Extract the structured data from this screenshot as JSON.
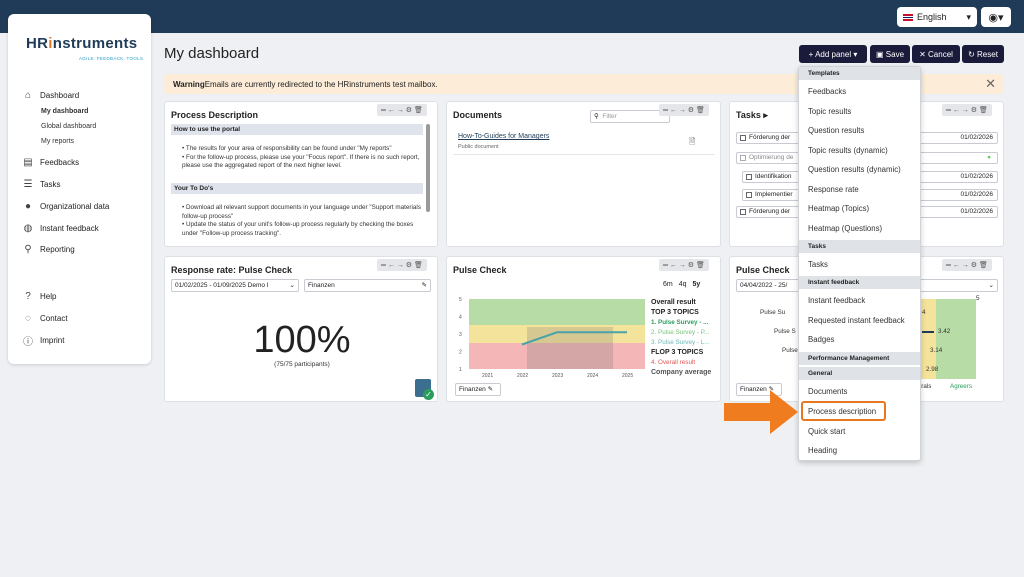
{
  "header": {
    "language": "English",
    "user_icon": "user-icon"
  },
  "sidebar": {
    "logo_main": "HR",
    "logo_mid": "i",
    "logo_rest": "nstruments",
    "tagline": "AGILE. FEEDBACK. TOOLS.",
    "dashboard": "Dashboard",
    "my_dashboard": "My dashboard",
    "global_dashboard": "Global dashboard",
    "my_reports": "My reports",
    "feedbacks": "Feedbacks",
    "tasks": "Tasks",
    "org_data": "Organizational data",
    "instant_feedback": "Instant feedback",
    "reporting": "Reporting",
    "help": "Help",
    "contact": "Contact",
    "imprint": "Imprint"
  },
  "page": {
    "title": "My dashboard",
    "add_panel": "+ Add panel",
    "save": "Save",
    "cancel": "Cancel",
    "reset": "Reset"
  },
  "warning": {
    "bold": "Warning",
    "text": " Emails are currently redirected to the HRinstruments test mailbox."
  },
  "process": {
    "title": "Process Description",
    "h1": "How to use the portal",
    "b1": "The results for your area of responsibility can be found under \"My reports\"",
    "b2": "For the follow-up process, please use your \"Focus report\". If there is no such report, please use the aggregated report of the next higher level.",
    "h2": "Your To Do's",
    "b3": "Download all relevant support documents in your language under \"Support materials follow-up process\"",
    "b4": "Update the status of your unit's follow-up process regularly by checking the boxes under \"Follow-up process tracking\"."
  },
  "documents": {
    "title": "Documents",
    "filter": "Filter",
    "doc_name": "How-To-Guides for Managers",
    "doc_sub": "Public document"
  },
  "tasks": {
    "title": "Tasks",
    "items": [
      {
        "label": "Förderung der",
        "date": "01/02/2026"
      },
      {
        "label": "Optimierung de",
        "date": ""
      },
      {
        "label": "Identifikation",
        "date": "01/02/2026"
      },
      {
        "label": "Implementier",
        "date": "01/02/2026"
      },
      {
        "label": "Förderung der",
        "date": "01/02/2026"
      }
    ]
  },
  "response": {
    "title": "Response rate: Pulse Check",
    "period": "01/02/2025 - 01/09/2025 Demo I",
    "unit": "Finanzen",
    "value": "100%",
    "sub": "(75/75 participants)"
  },
  "pulse": {
    "title": "Pulse Check",
    "tabs": [
      "6m",
      "4q",
      "5y"
    ],
    "filter": "Finanzen",
    "overall": "Overall result",
    "top": "TOP 3 TOPICS",
    "t1": "1. Pulse Survey - ...",
    "t2": "2. Pulse Survey - P...",
    "t3": "3. Pulse Survey - L...",
    "flop": "FLOP 3 TOPICS",
    "f1": "4. Overall result",
    "company": "Company average"
  },
  "pulse2": {
    "title": "Pulse Check",
    "period": "04/04/2022 - 25/",
    "filter": "Finanzen",
    "r1": "Pulse Su",
    "r2": "Pulse S",
    "r3": "Pulse",
    "v1": "3.42",
    "v2": "3.14",
    "v3": "2.98",
    "v0": "4",
    "l1": "utrals",
    "l2": "Agreers",
    "top": "5"
  },
  "menu": {
    "templates": "Templates",
    "items1": [
      "Feedbacks",
      "Topic results",
      "Question results",
      "Topic results (dynamic)",
      "Question results (dynamic)",
      "Response rate",
      "Heatmap (Topics)",
      "Heatmap (Questions)"
    ],
    "tasks_h": "Tasks",
    "tasks_i": "Tasks",
    "instant_h": "Instant feedback",
    "instant_i": [
      "Instant feedback",
      "Requested instant feedback",
      "Badges"
    ],
    "perf_h": "Performance Management",
    "general_h": "General",
    "general_i": [
      "Documents",
      "Process description",
      "Quick start",
      "Heading"
    ]
  },
  "chart_data": {
    "type": "line",
    "x": [
      "2021",
      "2022",
      "2023",
      "2024",
      "2025"
    ],
    "y_ticks": [
      "1",
      "2",
      "3",
      "4",
      "5"
    ],
    "ylim": [
      1,
      5
    ],
    "series": [
      {
        "values": [
          null,
          2.4,
          3.1,
          3.1,
          3.1
        ]
      }
    ]
  }
}
